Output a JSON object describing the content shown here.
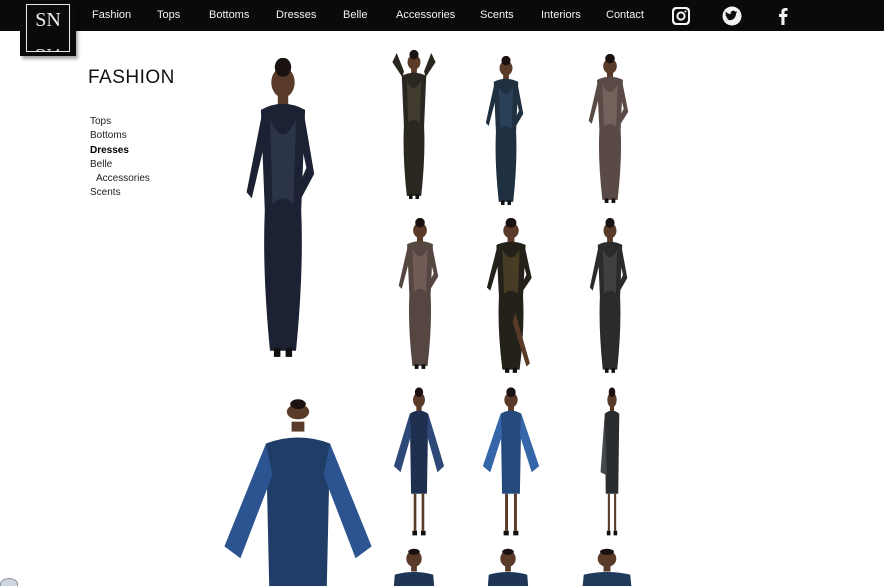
{
  "brand": {
    "logo_text": "SN"
  },
  "nav": {
    "items": [
      {
        "label": "Fashion"
      },
      {
        "label": "Tops"
      },
      {
        "label": "Bottoms"
      },
      {
        "label": "Dresses"
      },
      {
        "label": "Belle"
      },
      {
        "label": "Accessories"
      },
      {
        "label": "Scents"
      },
      {
        "label": "Interiors"
      },
      {
        "label": "Contact"
      }
    ],
    "social": [
      "instagram-icon",
      "twitter-icon",
      "facebook-icon"
    ]
  },
  "page": {
    "title": "FASHION"
  },
  "subnav": {
    "items": [
      {
        "label": "Tops"
      },
      {
        "label": "Bottoms"
      },
      {
        "label": "Dresses",
        "active": true
      },
      {
        "label": "Belle"
      },
      {
        "label": "Accessories",
        "child": true
      },
      {
        "label": "Scents"
      }
    ]
  },
  "gallery": {
    "photos": [
      {
        "name": "photo-navy-sequin-gown-large",
        "dress": "#1c2233",
        "accent": "#3a4660"
      },
      {
        "name": "photo-black-sequin-gown-arms-up",
        "dress": "#2a2620",
        "accent": "#5a5040"
      },
      {
        "name": "photo-navy-gown-back",
        "dress": "#1f3140",
        "accent": "#335070"
      },
      {
        "name": "photo-champagne-gown-pose-1",
        "dress": "#5a4a46",
        "accent": "#8c7870"
      },
      {
        "name": "photo-champagne-gown-pose-2",
        "dress": "#564641",
        "accent": "#8a726a"
      },
      {
        "name": "photo-black-gold-gown-leg",
        "dress": "#24211a",
        "accent": "#6a5a30"
      },
      {
        "name": "photo-black-sequin-gown-pose",
        "dress": "#2b2b2b",
        "accent": "#555"
      },
      {
        "name": "photo-blue-cape-dress-large",
        "dress": "#1f3d66",
        "accent": "#2c5490"
      },
      {
        "name": "photo-navy-cape-dress-1",
        "dress": "#1e2f4f",
        "accent": "#2e4878"
      },
      {
        "name": "photo-blue-cape-dress-2",
        "dress": "#244a7d",
        "accent": "#3466a8"
      },
      {
        "name": "photo-charcoal-cape-dress",
        "dress": "#2a2d30",
        "accent": "#45494e"
      },
      {
        "name": "photo-partial-1",
        "dress": "#1e3556",
        "accent": "#2e4a78"
      },
      {
        "name": "photo-partial-2",
        "dress": "#1e3556",
        "accent": "#2e4a78"
      },
      {
        "name": "photo-partial-3",
        "dress": "#203a5c",
        "accent": "#6a4e3a"
      }
    ]
  },
  "colors": {
    "topbar": "#0a0a0a",
    "nav_text": "#f2f2f2",
    "skin": "#5a3a28"
  }
}
